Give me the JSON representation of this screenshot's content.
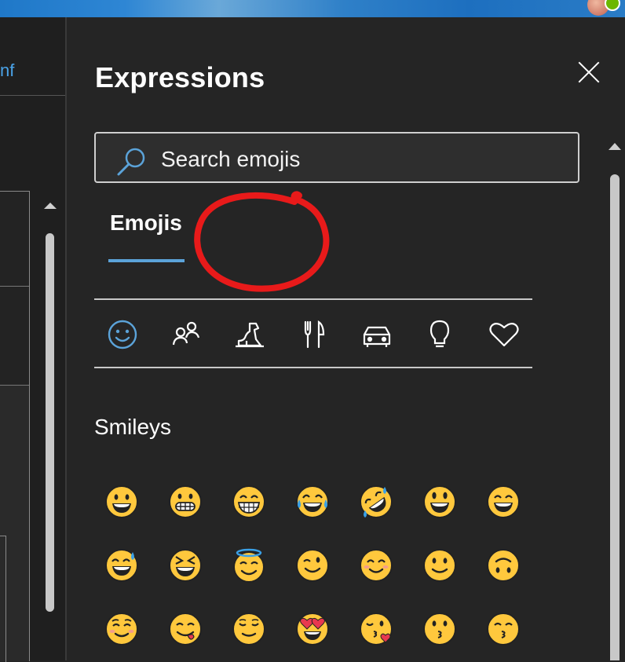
{
  "left_pane": {
    "link_text": "nf"
  },
  "panel": {
    "title": "Expressions",
    "search": {
      "placeholder": "Search emojis"
    },
    "tabs": [
      {
        "label": "Emojis",
        "selected": true
      }
    ],
    "categories": [
      "smileys-icon",
      "people-icon",
      "animals-icon",
      "food-icon",
      "travel-icon",
      "objects-icon",
      "symbols-icon"
    ],
    "section_title": "Smileys",
    "emojis": [
      [
        "grinning-face",
        "grimacing-face",
        "beaming-face",
        "tears-of-joy-face",
        "rolling-laughing-face",
        "smiley-face",
        "grinning-smiling-eyes-face"
      ],
      [
        "grinning-sweat-face",
        "squinting-face",
        "halo-face",
        "winking-face",
        "smiling-eyes-face",
        "slightly-smiling-face",
        "upside-down-face"
      ],
      [
        "relieved-smiling-face",
        "savoring-face",
        "relieved-face",
        "heart-eyes-face",
        "kissing-heart-face",
        "kissing-face",
        "kissing-smiling-eyes-face"
      ]
    ]
  },
  "colors": {
    "accent": "#5ba3d9",
    "annotation": "#e81a1a",
    "emoji_yellow": "#ffc83d",
    "background": "#252525"
  }
}
